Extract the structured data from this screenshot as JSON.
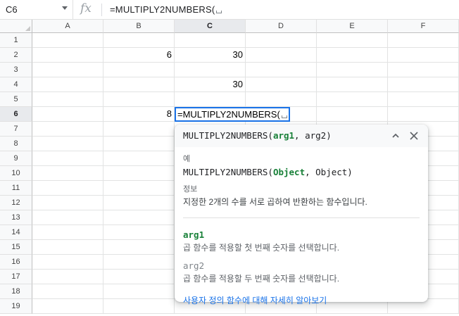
{
  "formula_bar": {
    "cell_ref": "C6",
    "fx": "fx",
    "formula": "=MULTIPLY2NUMBERS("
  },
  "columns": [
    "A",
    "B",
    "C",
    "D",
    "E",
    "F"
  ],
  "selected_column": "C",
  "rows": [
    "1",
    "2",
    "3",
    "4",
    "5",
    "6",
    "7",
    "8",
    "9",
    "10",
    "11",
    "12",
    "13",
    "14",
    "15",
    "16",
    "17",
    "18",
    "19"
  ],
  "selected_row": "6",
  "cells": {
    "B2": "6",
    "C2": "30",
    "C4": "30",
    "B6": "8",
    "C6": "=MULTIPLY2NUMBERS("
  },
  "popup": {
    "signature_fn": "MULTIPLY2NUMBERS(",
    "signature_arg1": "arg1",
    "signature_sep": ", ",
    "signature_rest": "arg2)",
    "example_label": "예",
    "example_fn": "MULTIPLY2NUMBERS(",
    "example_arg1": "Object",
    "example_rest": ", Object)",
    "info_label": "정보",
    "info_text": "지정한 2개의 수를 서로 곱하여 반환하는 함수입니다.",
    "args": [
      {
        "name": "arg1",
        "desc": "곱 함수를 적용할 첫 번째 숫자를 선택합니다."
      },
      {
        "name": "arg2",
        "desc": "곱 함수를 적용할 두 번째 숫자를 선택합니다."
      }
    ],
    "learn_more": "사용자 정의 함수에 대해 자세히 알아보기"
  }
}
